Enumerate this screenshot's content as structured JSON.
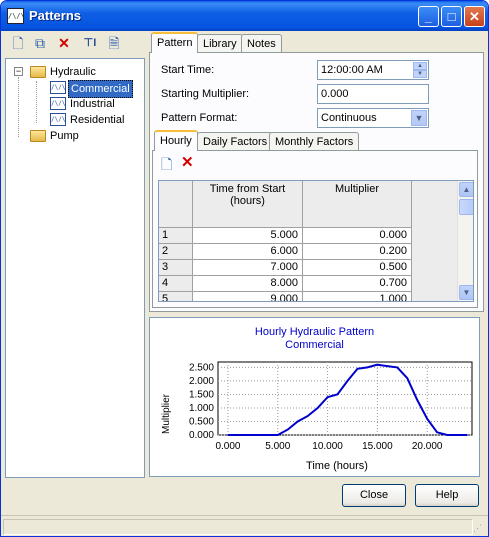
{
  "window": {
    "title": "Patterns",
    "icon": "pattern-icon",
    "controls": [
      "minimize",
      "maximize",
      "close"
    ]
  },
  "toolbar": {
    "icons": [
      "new-document-icon",
      "copy-icon",
      "delete-x-icon",
      "rename-icon",
      "properties-icon"
    ]
  },
  "tree": {
    "root": "Hydraulic",
    "children": [
      "Commercial",
      "Industrial",
      "Residential"
    ],
    "selected": "Commercial",
    "sibling": "Pump"
  },
  "tabs": [
    "Pattern",
    "Library",
    "Notes"
  ],
  "active_tab": "Pattern",
  "form": {
    "start_time_label": "Start Time:",
    "start_time_value": "12:00:00 AM",
    "starting_multiplier_label": "Starting Multiplier:",
    "starting_multiplier_value": "0.000",
    "pattern_format_label": "Pattern Format:",
    "pattern_format_value": "Continuous"
  },
  "subtabs": [
    "Hourly",
    "Daily Factors",
    "Monthly Factors"
  ],
  "active_subtab": "Hourly",
  "grid": {
    "headers": [
      "Time from Start\n(hours)",
      "Multiplier"
    ],
    "header_col1_line1": "Time from Start",
    "header_col1_line2": "(hours)",
    "header_col2": "Multiplier",
    "rows": [
      {
        "n": "1",
        "time": "5.000",
        "mult": "0.000"
      },
      {
        "n": "2",
        "time": "6.000",
        "mult": "0.200"
      },
      {
        "n": "3",
        "time": "7.000",
        "mult": "0.500"
      },
      {
        "n": "4",
        "time": "8.000",
        "mult": "0.700"
      },
      {
        "n": "5",
        "time": "9.000",
        "mult": "1.000"
      }
    ]
  },
  "chart_data": {
    "type": "line",
    "title": "Hourly Hydraulic Pattern",
    "subtitle": "Commercial",
    "xlabel": "Time (hours)",
    "ylabel": "Multiplier",
    "xlim": [
      -1,
      24.5
    ],
    "ylim": [
      0,
      2.7
    ],
    "xticks": [
      "0.000",
      "5.000",
      "10.000",
      "15.000",
      "20.000"
    ],
    "yticks": [
      "0.000",
      "0.500",
      "1.000",
      "1.500",
      "2.000",
      "2.500"
    ],
    "grid": true,
    "x": [
      0,
      5,
      6,
      7,
      8,
      9,
      10,
      11,
      12,
      13,
      14,
      15,
      16,
      17,
      18,
      19,
      20,
      21,
      22,
      23,
      24
    ],
    "y": [
      0,
      0,
      0.2,
      0.5,
      0.7,
      1.0,
      1.4,
      1.5,
      2.0,
      2.45,
      2.5,
      2.6,
      2.55,
      2.5,
      2.1,
      1.3,
      0.6,
      0.1,
      0,
      0,
      0
    ],
    "line_color": "#0000cc"
  },
  "buttons": {
    "close": "Close",
    "help": "Help"
  }
}
